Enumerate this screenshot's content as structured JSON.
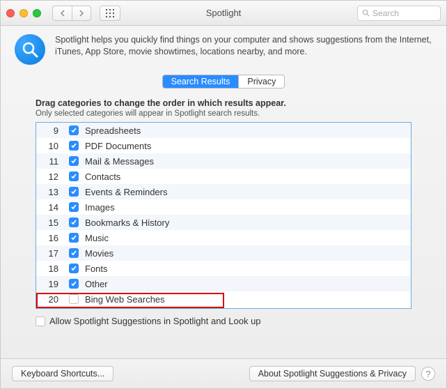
{
  "window": {
    "title": "Spotlight"
  },
  "search": {
    "placeholder": "Search"
  },
  "intro": {
    "text": "Spotlight helps you quickly find things on your computer and shows suggestions from the Internet, iTunes, App Store, movie showtimes, locations nearby, and more."
  },
  "tabs": {
    "search_results": "Search Results",
    "privacy": "Privacy",
    "active": "search_results"
  },
  "panel": {
    "heading": "Drag categories to change the order in which results appear.",
    "subtext": "Only selected categories will appear in Spotlight search results."
  },
  "categories": [
    {
      "num": 9,
      "label": "Spreadsheets",
      "checked": true
    },
    {
      "num": 10,
      "label": "PDF Documents",
      "checked": true
    },
    {
      "num": 11,
      "label": "Mail & Messages",
      "checked": true
    },
    {
      "num": 12,
      "label": "Contacts",
      "checked": true
    },
    {
      "num": 13,
      "label": "Events & Reminders",
      "checked": true
    },
    {
      "num": 14,
      "label": "Images",
      "checked": true
    },
    {
      "num": 15,
      "label": "Bookmarks & History",
      "checked": true
    },
    {
      "num": 16,
      "label": "Music",
      "checked": true
    },
    {
      "num": 17,
      "label": "Movies",
      "checked": true
    },
    {
      "num": 18,
      "label": "Fonts",
      "checked": true
    },
    {
      "num": 19,
      "label": "Other",
      "checked": true
    },
    {
      "num": 20,
      "label": "Bing Web Searches",
      "checked": false
    }
  ],
  "allow": {
    "label": "Allow Spotlight Suggestions in Spotlight and Look up",
    "checked": false
  },
  "footer": {
    "keyboard": "Keyboard Shortcuts...",
    "about": "About Spotlight Suggestions & Privacy"
  },
  "colors": {
    "accent": "#2a8cff",
    "highlight": "#d90000"
  }
}
